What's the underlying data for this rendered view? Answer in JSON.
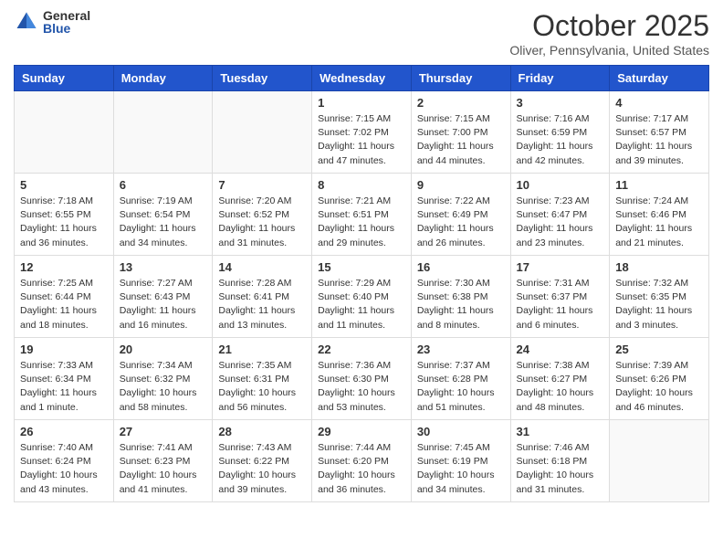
{
  "header": {
    "logo_general": "General",
    "logo_blue": "Blue",
    "month_title": "October 2025",
    "location": "Oliver, Pennsylvania, United States"
  },
  "days_of_week": [
    "Sunday",
    "Monday",
    "Tuesday",
    "Wednesday",
    "Thursday",
    "Friday",
    "Saturday"
  ],
  "weeks": [
    [
      {
        "day": "",
        "info": ""
      },
      {
        "day": "",
        "info": ""
      },
      {
        "day": "",
        "info": ""
      },
      {
        "day": "1",
        "info": "Sunrise: 7:15 AM\nSunset: 7:02 PM\nDaylight: 11 hours\nand 47 minutes."
      },
      {
        "day": "2",
        "info": "Sunrise: 7:15 AM\nSunset: 7:00 PM\nDaylight: 11 hours\nand 44 minutes."
      },
      {
        "day": "3",
        "info": "Sunrise: 7:16 AM\nSunset: 6:59 PM\nDaylight: 11 hours\nand 42 minutes."
      },
      {
        "day": "4",
        "info": "Sunrise: 7:17 AM\nSunset: 6:57 PM\nDaylight: 11 hours\nand 39 minutes."
      }
    ],
    [
      {
        "day": "5",
        "info": "Sunrise: 7:18 AM\nSunset: 6:55 PM\nDaylight: 11 hours\nand 36 minutes."
      },
      {
        "day": "6",
        "info": "Sunrise: 7:19 AM\nSunset: 6:54 PM\nDaylight: 11 hours\nand 34 minutes."
      },
      {
        "day": "7",
        "info": "Sunrise: 7:20 AM\nSunset: 6:52 PM\nDaylight: 11 hours\nand 31 minutes."
      },
      {
        "day": "8",
        "info": "Sunrise: 7:21 AM\nSunset: 6:51 PM\nDaylight: 11 hours\nand 29 minutes."
      },
      {
        "day": "9",
        "info": "Sunrise: 7:22 AM\nSunset: 6:49 PM\nDaylight: 11 hours\nand 26 minutes."
      },
      {
        "day": "10",
        "info": "Sunrise: 7:23 AM\nSunset: 6:47 PM\nDaylight: 11 hours\nand 23 minutes."
      },
      {
        "day": "11",
        "info": "Sunrise: 7:24 AM\nSunset: 6:46 PM\nDaylight: 11 hours\nand 21 minutes."
      }
    ],
    [
      {
        "day": "12",
        "info": "Sunrise: 7:25 AM\nSunset: 6:44 PM\nDaylight: 11 hours\nand 18 minutes."
      },
      {
        "day": "13",
        "info": "Sunrise: 7:27 AM\nSunset: 6:43 PM\nDaylight: 11 hours\nand 16 minutes."
      },
      {
        "day": "14",
        "info": "Sunrise: 7:28 AM\nSunset: 6:41 PM\nDaylight: 11 hours\nand 13 minutes."
      },
      {
        "day": "15",
        "info": "Sunrise: 7:29 AM\nSunset: 6:40 PM\nDaylight: 11 hours\nand 11 minutes."
      },
      {
        "day": "16",
        "info": "Sunrise: 7:30 AM\nSunset: 6:38 PM\nDaylight: 11 hours\nand 8 minutes."
      },
      {
        "day": "17",
        "info": "Sunrise: 7:31 AM\nSunset: 6:37 PM\nDaylight: 11 hours\nand 6 minutes."
      },
      {
        "day": "18",
        "info": "Sunrise: 7:32 AM\nSunset: 6:35 PM\nDaylight: 11 hours\nand 3 minutes."
      }
    ],
    [
      {
        "day": "19",
        "info": "Sunrise: 7:33 AM\nSunset: 6:34 PM\nDaylight: 11 hours\nand 1 minute."
      },
      {
        "day": "20",
        "info": "Sunrise: 7:34 AM\nSunset: 6:32 PM\nDaylight: 10 hours\nand 58 minutes."
      },
      {
        "day": "21",
        "info": "Sunrise: 7:35 AM\nSunset: 6:31 PM\nDaylight: 10 hours\nand 56 minutes."
      },
      {
        "day": "22",
        "info": "Sunrise: 7:36 AM\nSunset: 6:30 PM\nDaylight: 10 hours\nand 53 minutes."
      },
      {
        "day": "23",
        "info": "Sunrise: 7:37 AM\nSunset: 6:28 PM\nDaylight: 10 hours\nand 51 minutes."
      },
      {
        "day": "24",
        "info": "Sunrise: 7:38 AM\nSunset: 6:27 PM\nDaylight: 10 hours\nand 48 minutes."
      },
      {
        "day": "25",
        "info": "Sunrise: 7:39 AM\nSunset: 6:26 PM\nDaylight: 10 hours\nand 46 minutes."
      }
    ],
    [
      {
        "day": "26",
        "info": "Sunrise: 7:40 AM\nSunset: 6:24 PM\nDaylight: 10 hours\nand 43 minutes."
      },
      {
        "day": "27",
        "info": "Sunrise: 7:41 AM\nSunset: 6:23 PM\nDaylight: 10 hours\nand 41 minutes."
      },
      {
        "day": "28",
        "info": "Sunrise: 7:43 AM\nSunset: 6:22 PM\nDaylight: 10 hours\nand 39 minutes."
      },
      {
        "day": "29",
        "info": "Sunrise: 7:44 AM\nSunset: 6:20 PM\nDaylight: 10 hours\nand 36 minutes."
      },
      {
        "day": "30",
        "info": "Sunrise: 7:45 AM\nSunset: 6:19 PM\nDaylight: 10 hours\nand 34 minutes."
      },
      {
        "day": "31",
        "info": "Sunrise: 7:46 AM\nSunset: 6:18 PM\nDaylight: 10 hours\nand 31 minutes."
      },
      {
        "day": "",
        "info": ""
      }
    ]
  ]
}
